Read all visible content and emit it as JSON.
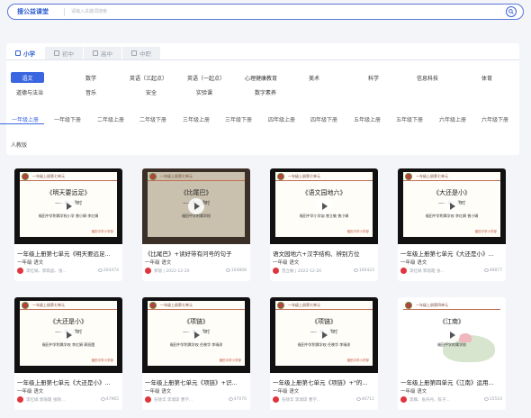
{
  "search": {
    "brand": "搜公益课堂",
    "placeholder": "请输入关键词搜索",
    "button_icon": "search-icon"
  },
  "stages": [
    {
      "label": "小学",
      "active": true
    },
    {
      "label": "初中",
      "active": false
    },
    {
      "label": "高中",
      "active": false
    },
    {
      "label": "中职",
      "active": false
    }
  ],
  "subjects": [
    {
      "label": "语文",
      "active": true
    },
    {
      "label": "数学",
      "active": false
    },
    {
      "label": "英语（三起点）",
      "active": false
    },
    {
      "label": "英语（一起点）",
      "active": false
    },
    {
      "label": "心理健康教育",
      "active": false
    },
    {
      "label": "美术",
      "active": false
    },
    {
      "label": "科学",
      "active": false
    },
    {
      "label": "信息科技",
      "active": false
    },
    {
      "label": "体育",
      "active": false
    },
    {
      "label": "道德与法治",
      "active": false
    },
    {
      "label": "音乐",
      "active": false
    },
    {
      "label": "安全",
      "active": false
    },
    {
      "label": "实验课",
      "active": false
    },
    {
      "label": "数字素养",
      "active": false
    }
  ],
  "grades": [
    {
      "label": "一年级上册",
      "active": true
    },
    {
      "label": "一年级下册",
      "active": false
    },
    {
      "label": "二年级上册",
      "active": false
    },
    {
      "label": "二年级下册",
      "active": false
    },
    {
      "label": "三年级上册",
      "active": false
    },
    {
      "label": "三年级下册",
      "active": false
    },
    {
      "label": "四年级上册",
      "active": false
    },
    {
      "label": "四年级下册",
      "active": false
    },
    {
      "label": "五年级上册",
      "active": false
    },
    {
      "label": "五年级下册",
      "active": false
    },
    {
      "label": "六年级上册",
      "active": false
    },
    {
      "label": "六年级下册",
      "active": false
    }
  ],
  "edition": "人教版",
  "cards": [
    {
      "title": "一年级上册第七单元《明天要远足...",
      "subject": "一年级 语文",
      "author": "李红娟、郭雨晶、张...",
      "views": "204474",
      "thumb": {
        "style": "slide",
        "header": "一年级上册第七单元",
        "title": "《明天要远足》",
        "subtitle": "——第一课时",
        "author_line": "福田中学附属学校小学 曾小娟 李红娟",
        "footer": "福田中学小学部"
      }
    },
    {
      "title": "《比尾巴》+读好带有问号的句子",
      "subject": "一年级 语文",
      "author": "郭丽",
      "date": "2022-12-20",
      "views": "104808",
      "thumb": {
        "style": "photo",
        "header": "一年级上册第七单元",
        "title": "《比尾巴》",
        "subtitle": "——第一课时",
        "author_line": "福田中学附属学校",
        "footer": ""
      }
    },
    {
      "title": "语文园地六+汉字结构、辨别方位",
      "subject": "一年级 语文",
      "author": "曾立敏",
      "date": "2022-12-20",
      "views": "100423",
      "thumb": {
        "style": "slide",
        "header": "一年级上册第七单元",
        "title": "《语文园地六》",
        "subtitle": "",
        "author_line": "福田中学小学部 曾立敏 曾小娟",
        "footer": "福田中学小学部"
      }
    },
    {
      "title": "一年级上册第七单元《大还是小》...",
      "subject": "一年级 语文",
      "author": "李红娟 郭丽霞 张...",
      "views": "49877",
      "thumb": {
        "style": "slide",
        "header": "一年级上册第七单元",
        "title": "《大还是小》",
        "subtitle": "——第一课时",
        "author_line": "福田中学附属学校 李红娟 曾小娟",
        "footer": "福田中学小学部"
      }
    },
    {
      "title": "一年级上册第七单元《大还是小》...",
      "subject": "一年级 语文",
      "author": "李红娟 郭丽霞 张晓...",
      "views": "47965",
      "thumb": {
        "style": "slide",
        "header": "一年级上册第七单元",
        "title": "《大还是小》",
        "subtitle": "——第二课时",
        "author_line": "福田中学附属学校 李红娟 郭丽霞",
        "footer": "福田中学小学部"
      }
    },
    {
      "title": "一年级上册第七单元《项链》+识...",
      "subject": "一年级 语文",
      "author": "任晓华 李瑞琼 曹学...",
      "views": "47070",
      "thumb": {
        "style": "slide",
        "header": "一年级上册第七单元",
        "title": "《项链》",
        "subtitle": "——第一课时",
        "author_line": "福田中学附属学校 任晓华 李瑞琼",
        "footer": "福田中学小学部"
      }
    },
    {
      "title": "一年级上册第七单元《项链》+\"的...",
      "subject": "一年级 语文",
      "author": "任晓华 李瑞琼 曹学...",
      "views": "40711",
      "thumb": {
        "style": "slide",
        "header": "一年级上册第七单元",
        "title": "《项链》",
        "subtitle": "——第二课时",
        "author_line": "福田中学附属学校 任晓华 李瑞琼",
        "footer": "福田中学小学部"
      }
    },
    {
      "title": "一年级上册第四单元《江南》运用...",
      "subject": "一年级 语文",
      "author": "李娜、张丹丹、陈子...",
      "views": "15510",
      "thumb": {
        "style": "ink",
        "header": "一年级上册第四单元",
        "title": "《江南》",
        "subtitle": "",
        "author_line": "福田中学附属学校",
        "footer": ""
      }
    }
  ],
  "colors": {
    "accent": "#3a67e0",
    "brand": "#2f5fd0",
    "avatar": "#e0353c"
  }
}
